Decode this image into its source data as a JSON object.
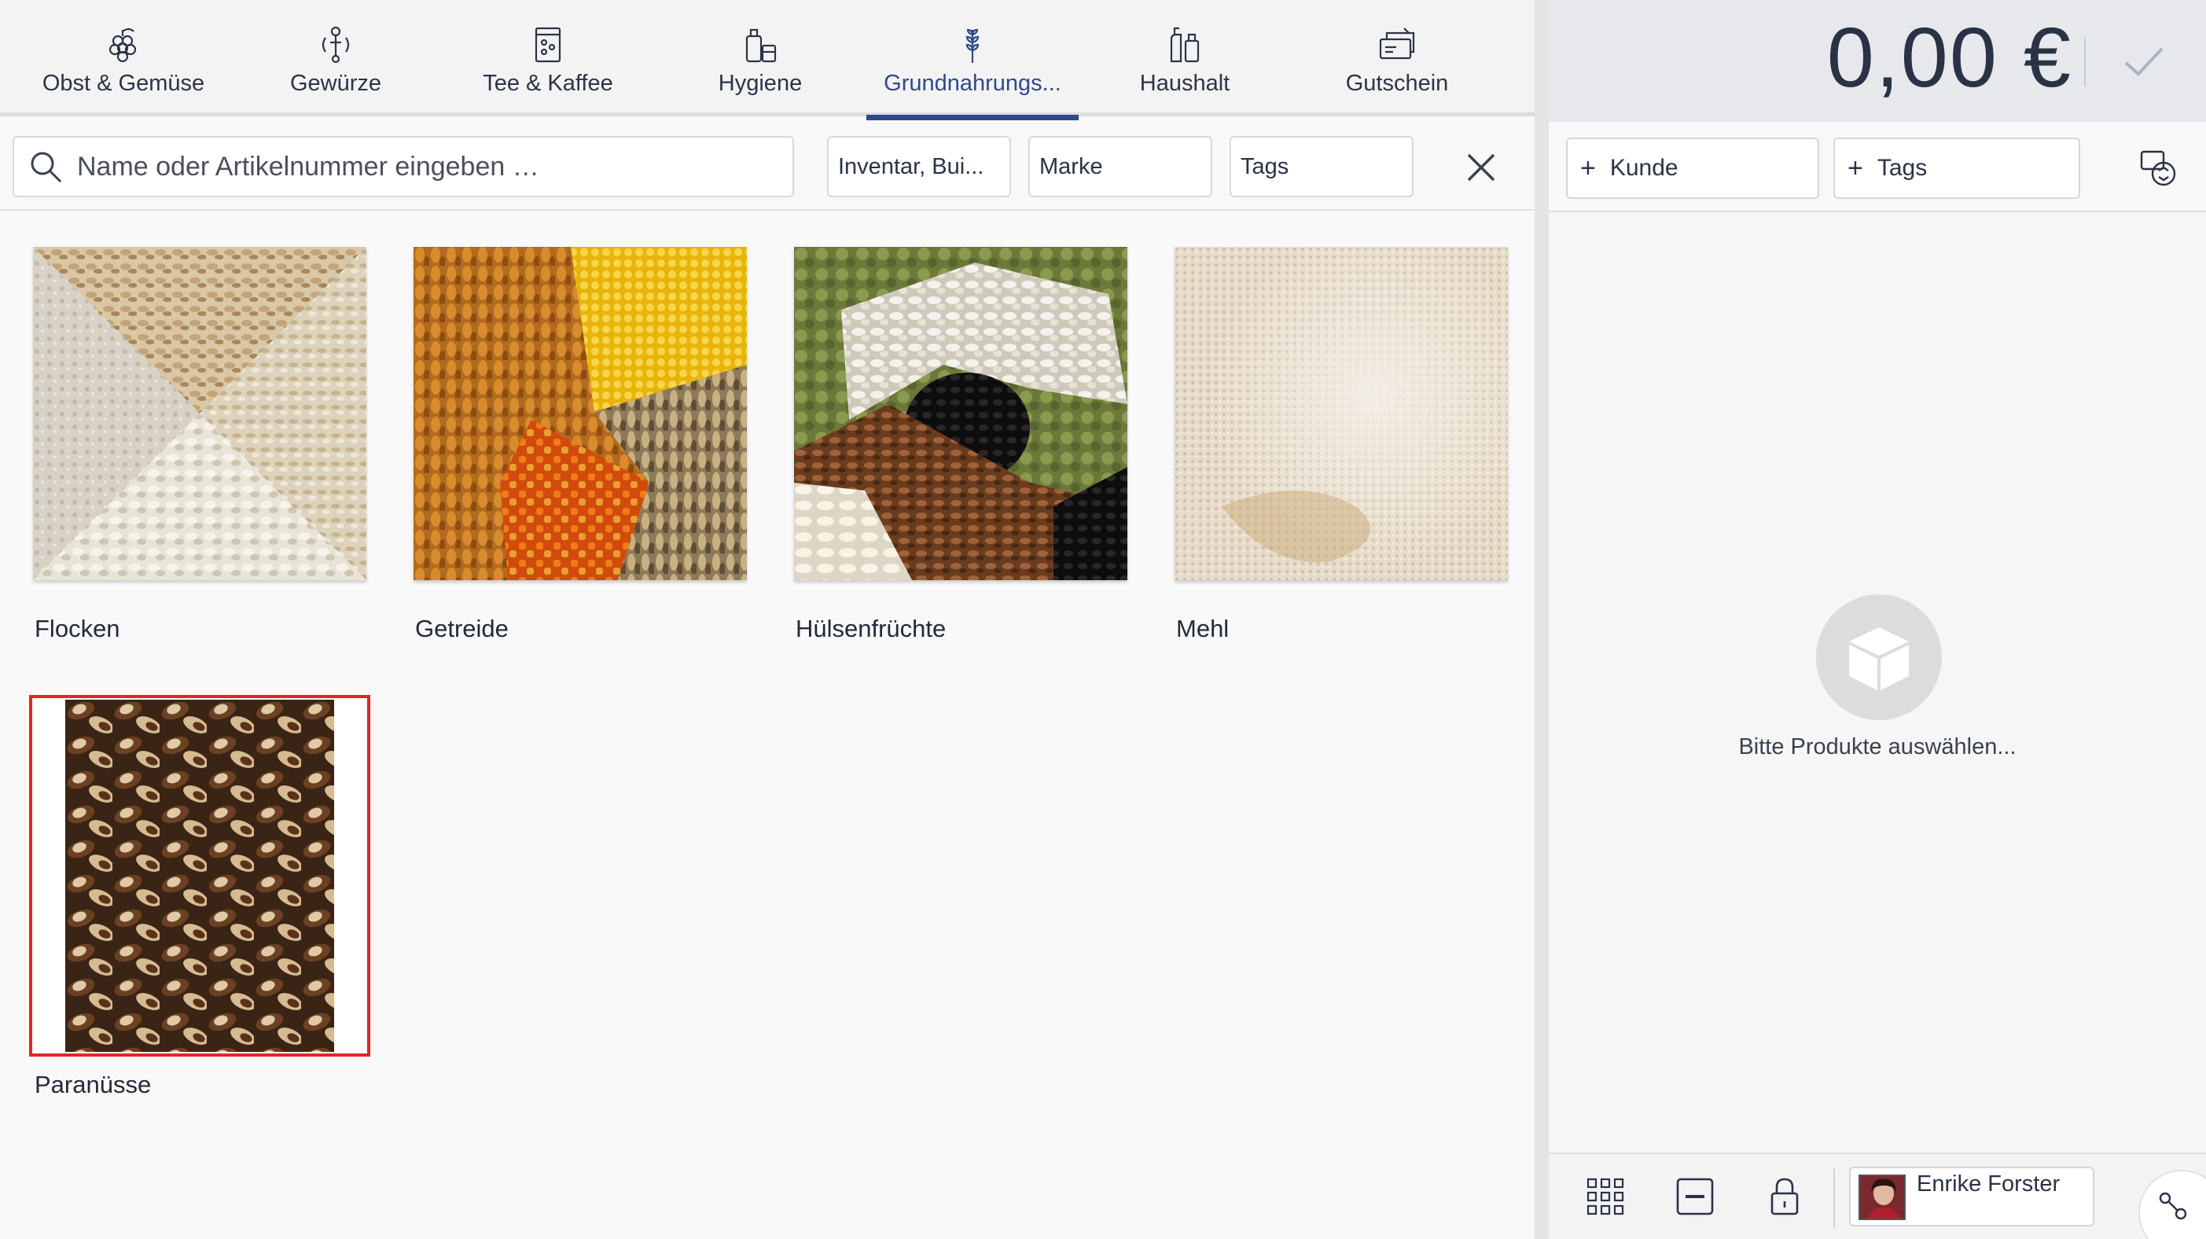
{
  "categories": [
    {
      "label": "Obst & Gemüse",
      "icon": "grapes-icon",
      "active": false
    },
    {
      "label": "Gewürze",
      "icon": "spices-icon",
      "active": false
    },
    {
      "label": "Tee & Kaffee",
      "icon": "tea-coffee-icon",
      "active": false
    },
    {
      "label": "Hygiene",
      "icon": "hygiene-icon",
      "active": false
    },
    {
      "label": "Grundnahrungs...",
      "icon": "wheat-icon",
      "active": true
    },
    {
      "label": "Haushalt",
      "icon": "household-icon",
      "active": false
    },
    {
      "label": "Gutschein",
      "icon": "voucher-icon",
      "active": false
    }
  ],
  "search": {
    "placeholder": "Name oder Artikelnummer eingeben …",
    "value": ""
  },
  "filters": {
    "inventory": "Inventar, Bui...",
    "brand": "Marke",
    "tags": "Tags"
  },
  "products": [
    {
      "name": "Flocken",
      "image": "oat-flakes-image"
    },
    {
      "name": "Getreide",
      "image": "grains-image"
    },
    {
      "name": "Hülsenfrüchte",
      "image": "legumes-image"
    },
    {
      "name": "Mehl",
      "image": "flour-image"
    },
    {
      "name": "Paranüsse",
      "image": "brazil-nuts-image",
      "selected": true
    }
  ],
  "cart": {
    "total": "0,00 €",
    "customer_button": "Kunde",
    "tags_button": "Tags",
    "empty_message": "Bitte Produkte auswählen..."
  },
  "user": {
    "name": "Enrike Forster"
  },
  "colors": {
    "accent": "#2f4a8a",
    "selection": "#e0262a"
  }
}
